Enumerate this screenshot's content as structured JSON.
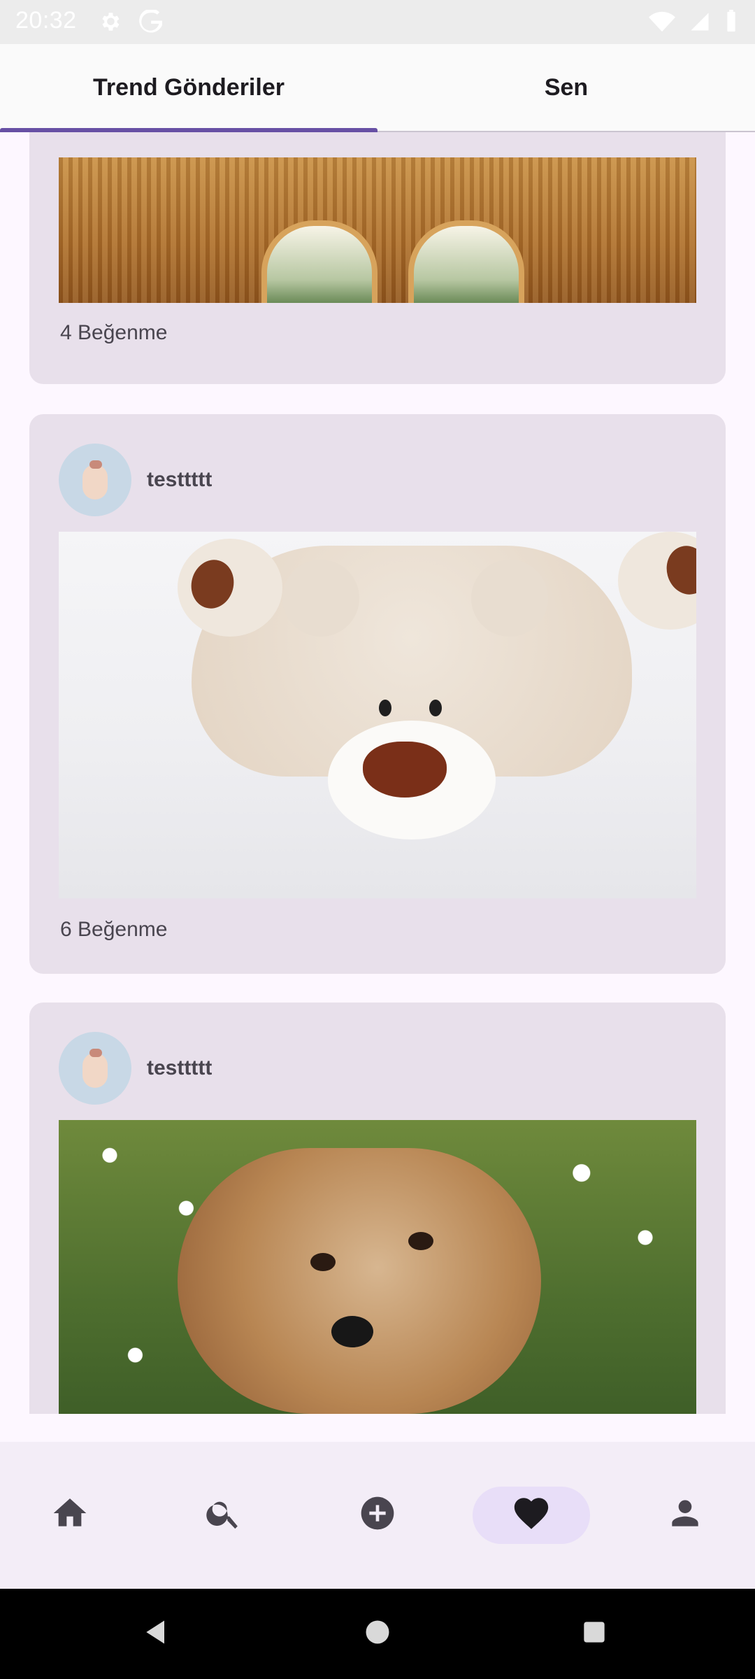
{
  "status_bar": {
    "time": "20:32"
  },
  "tabs": {
    "left": "Trend Gönderiler",
    "right": "Sen"
  },
  "posts": [
    {
      "likes": "4 Beğenme"
    },
    {
      "username": "testtttt",
      "likes": "6 Beğenme"
    },
    {
      "username": "testtttt"
    }
  ],
  "bottom_nav": {
    "items": [
      "home-icon",
      "search-icon",
      "add-icon",
      "favorites-icon",
      "profile-icon"
    ],
    "selected": "favorites-icon",
    "accent_color": "#6750a4"
  }
}
